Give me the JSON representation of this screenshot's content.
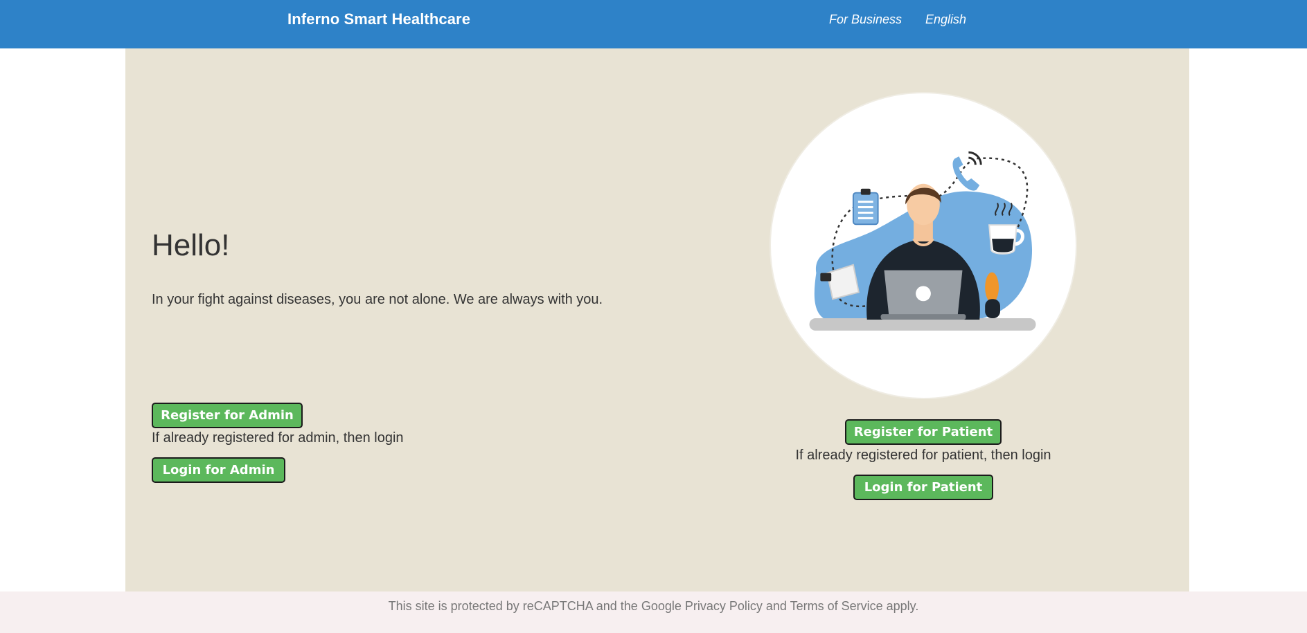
{
  "header": {
    "brand": "Inferno Smart Healthcare",
    "nav": [
      {
        "label": "For Business"
      },
      {
        "label": "English"
      }
    ]
  },
  "hero": {
    "title": "Hello!",
    "subtitle": "In your fight against diseases, you are not alone. We are always with you."
  },
  "admin": {
    "register_label": "Register for Admin",
    "hint": "If already registered for admin, then login",
    "login_label": "Login for Admin"
  },
  "patient": {
    "register_label": "Register for Patient",
    "hint": "If already registered for patient, then login",
    "login_label": "Login for Patient"
  },
  "footer": {
    "text": "This site is protected by reCAPTCHA and the Google Privacy Policy and Terms of Service apply."
  },
  "colors": {
    "header_bg": "#2e82c8",
    "main_bg": "#e8e3d4",
    "button_green": "#5cb85c",
    "footer_bg": "#f7eff0"
  },
  "illustration": {
    "icons": [
      "person-at-laptop",
      "phone-icon",
      "clipboard-icon",
      "coffee-cup-icon",
      "plant-icon",
      "pin-icon"
    ]
  }
}
